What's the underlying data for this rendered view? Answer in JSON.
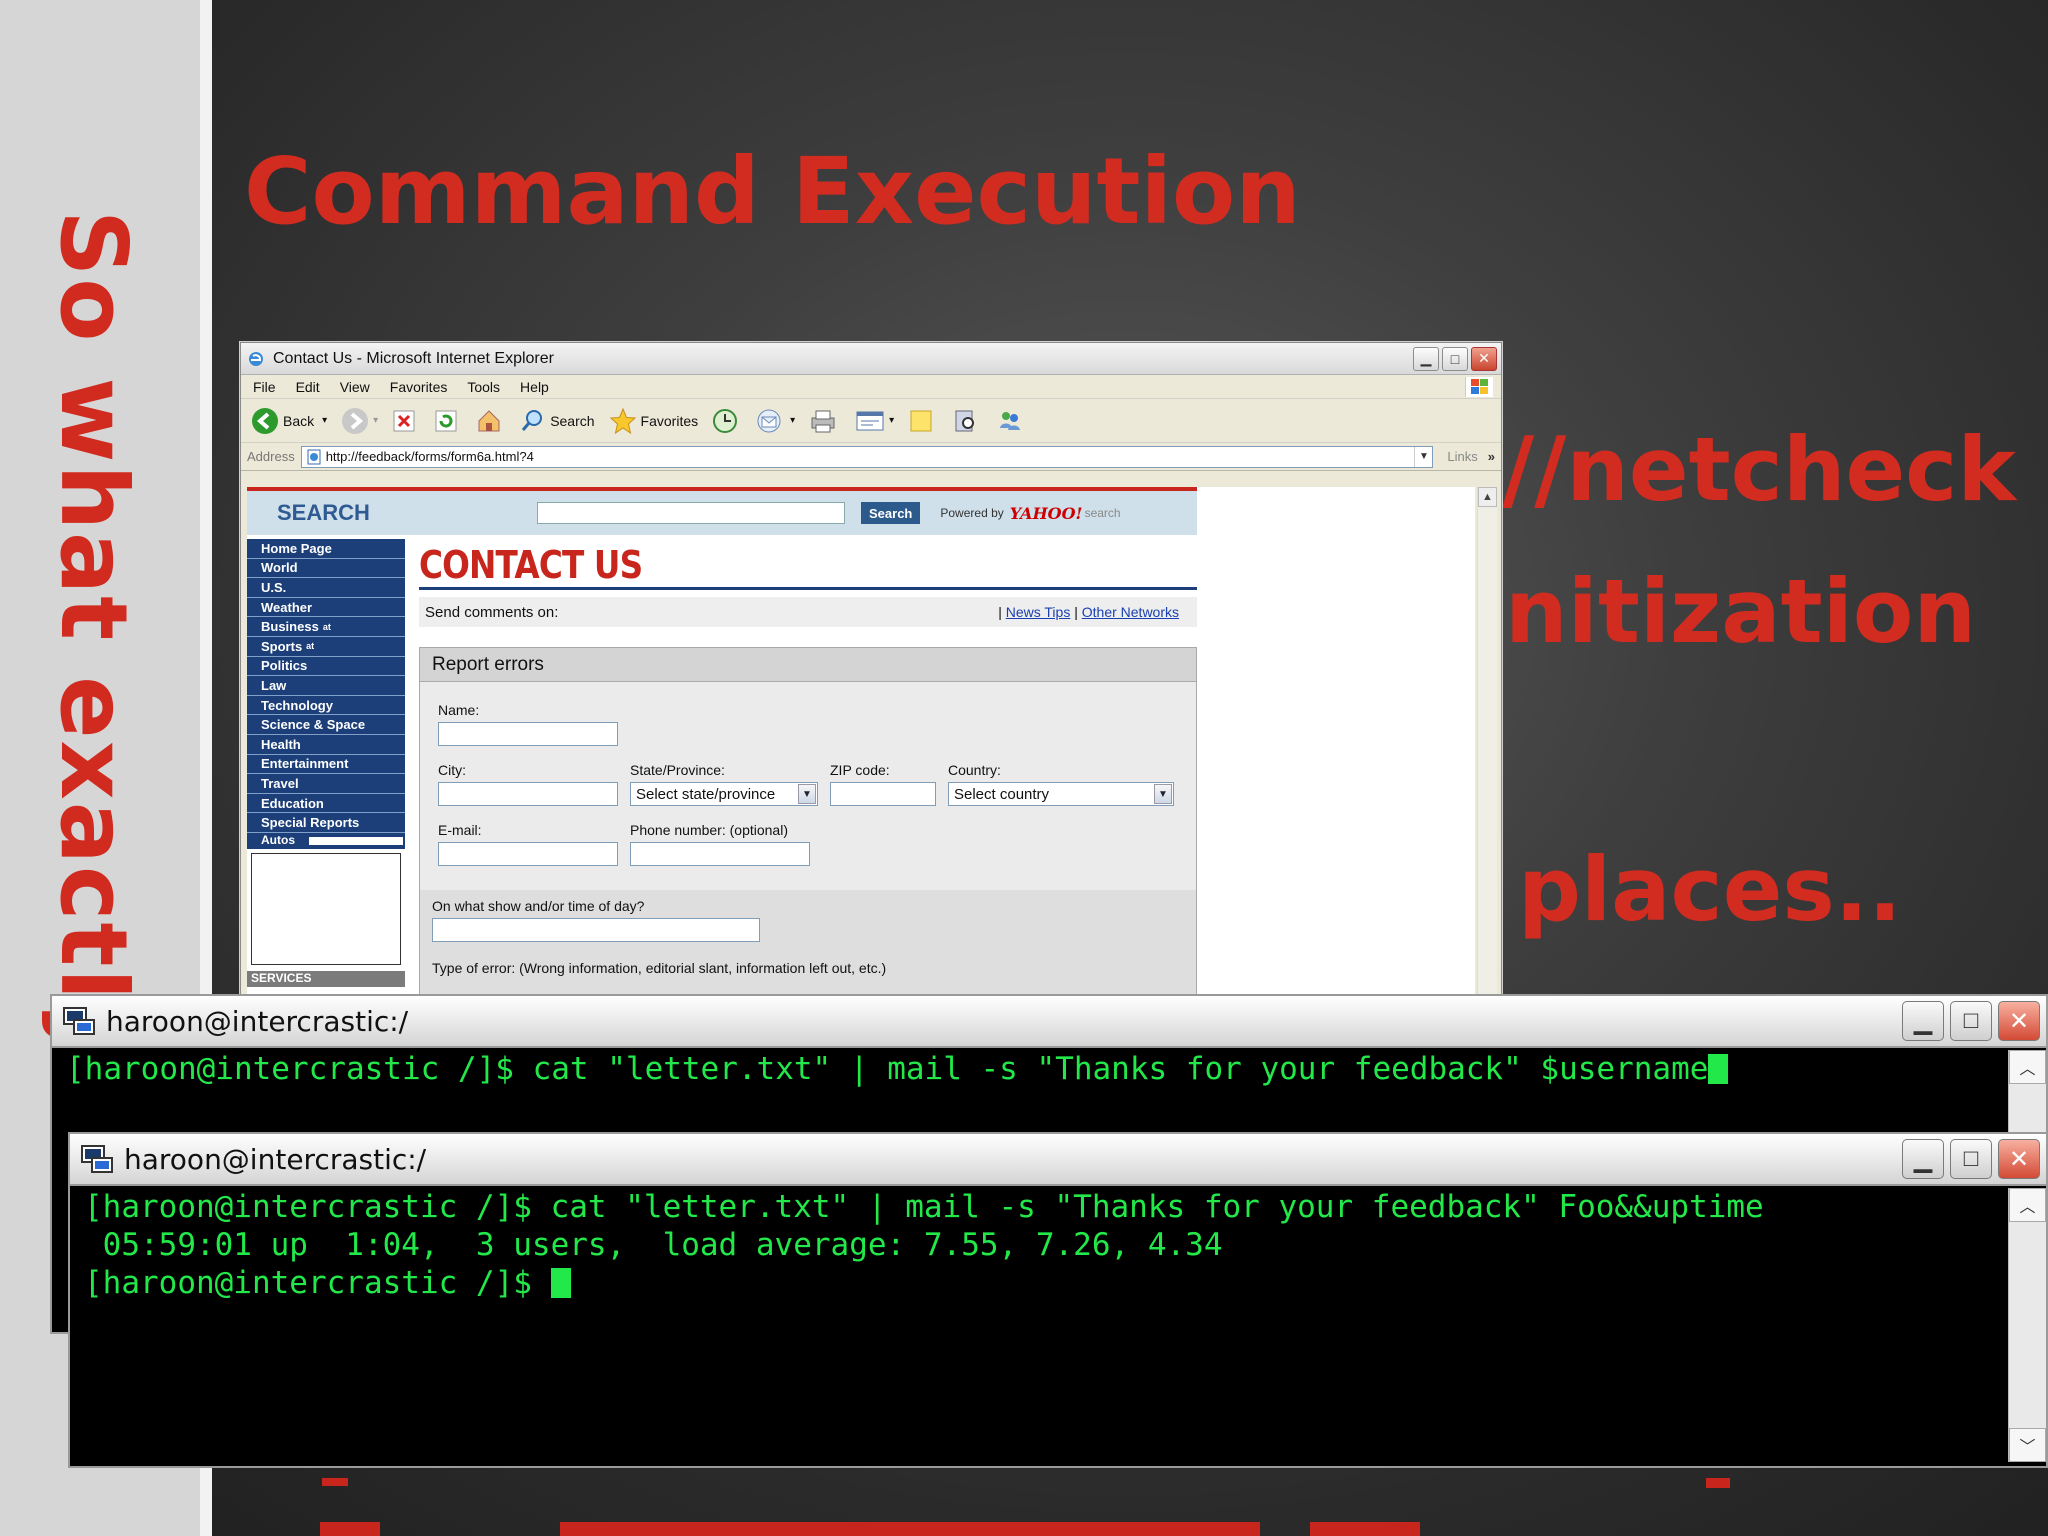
{
  "slide": {
    "title": "Command Execution",
    "side_title": "So what exactly",
    "fragments": [
      "//netcheck",
      "nitization",
      "places.."
    ]
  },
  "ie": {
    "window_title": "Contact Us - Microsoft Internet Explorer",
    "menu": [
      "File",
      "Edit",
      "View",
      "Favorites",
      "Tools",
      "Help"
    ],
    "toolbar": {
      "back": "Back",
      "search": "Search",
      "favorites": "Favorites"
    },
    "address_label": "Address",
    "address_url": "http://feedback/forms/form6a.html?4",
    "links_label": "Links",
    "page": {
      "search_label": "SEARCH",
      "search_button": "Search",
      "powered_by": "Powered by",
      "yahoo": "YAHOO!",
      "yahoo_search": "search",
      "nav": [
        "Home Page",
        "World",
        "U.S.",
        "Weather",
        "Business",
        "Sports",
        "Politics",
        "Law",
        "Technology",
        "Science & Space",
        "Health",
        "Entertainment",
        "Travel",
        "Education",
        "Special Reports"
      ],
      "nav_sup": {
        "business": "at",
        "sports": "at"
      },
      "nav_autos": "Autos",
      "services": "SERVICES",
      "heading": "CONTACT US",
      "send_comments": "Send comments on:",
      "link_news_tips": "News Tips",
      "link_other_networks": "Other Networks",
      "form": {
        "title": "Report errors",
        "name_label": "Name:",
        "city_label": "City:",
        "state_label": "State/Province:",
        "state_value": "Select state/province",
        "zip_label": "ZIP code:",
        "country_label": "Country:",
        "country_value": "Select country",
        "email_label": "E-mail:",
        "phone_label": "Phone number: (optional)",
        "show_label": "On what show and/or time of day?",
        "error_type_label": "Type of error: (Wrong information, editorial slant, information left out, etc.)"
      }
    }
  },
  "term1": {
    "title": "haroon@intercrastic:/",
    "line1": "[haroon@intercrastic /]$ cat \"letter.txt\" | mail -s \"Thanks for your feedback\" $username"
  },
  "term2": {
    "title": "haroon@intercrastic:/",
    "line1": "[haroon@intercrastic /]$ cat \"letter.txt\" | mail -s \"Thanks for your feedback\" Foo&&uptime",
    "line2": " 05:59:01 up  1:04,  3 users,  load average: 7.55, 7.26, 4.34",
    "line3": "[haroon@intercrastic /]$ "
  },
  "colors": {
    "accent_red": "#d22b20",
    "terminal_green": "#22e84a",
    "nav_blue": "#1c3f7a"
  }
}
